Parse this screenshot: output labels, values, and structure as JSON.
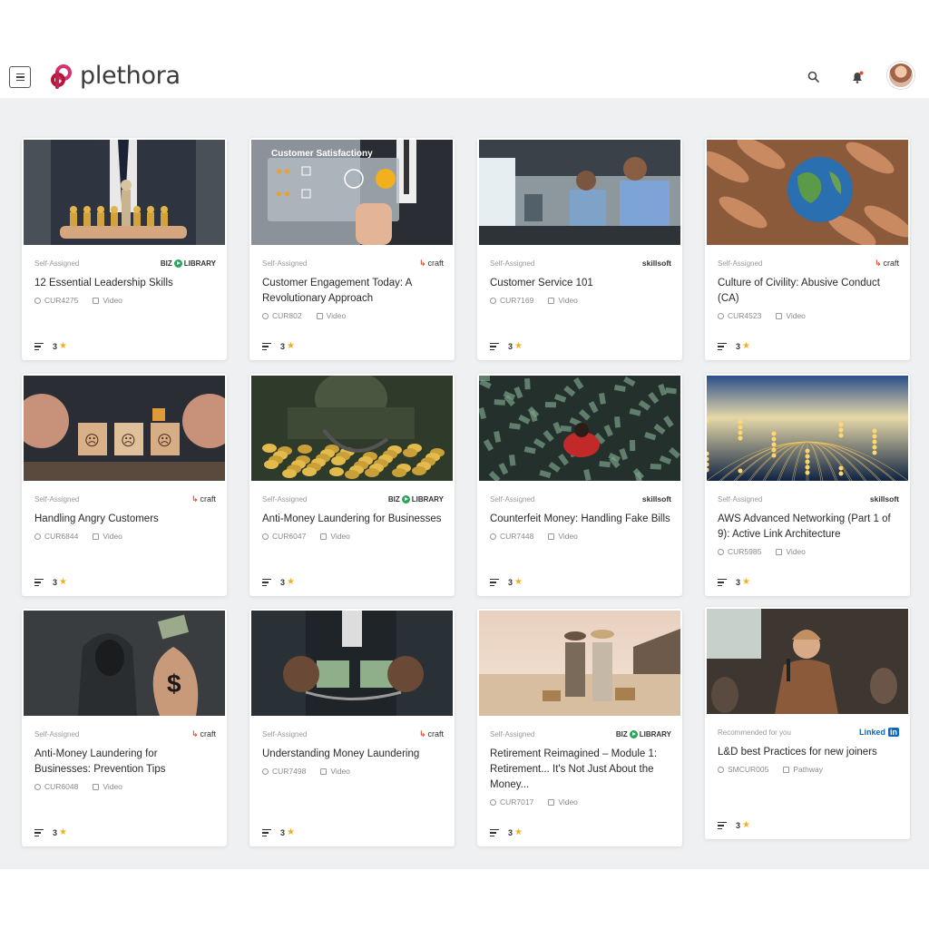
{
  "app": {
    "name": "plethora"
  },
  "colors": {
    "brand_pink": "#d6336c",
    "brand_red": "#b0183a",
    "star": "#f2b01e",
    "bg": "#eef0f2"
  },
  "header": {
    "menu_icon": "menu-icon",
    "search_icon": "search-icon",
    "bell_icon": "bell-icon",
    "avatar": "user-avatar"
  },
  "cards": [
    {
      "assign": "Self-Assigned",
      "provider": "BIZ LIBRARY",
      "title": "12 Essential Leadership Skills",
      "code": "CUR4275",
      "format": "Video",
      "rating": "3"
    },
    {
      "assign": "Self-Assigned",
      "provider": "craft",
      "title": "Customer Engagement Today: A Revolutionary Approach",
      "code": "CUR802",
      "format": "Video",
      "rating": "3",
      "thumb_text": "Customer Satisfactiony"
    },
    {
      "assign": "Self-Assigned",
      "provider": "skillsoft",
      "title": "Customer Service 101",
      "code": "CUR7169",
      "format": "Video",
      "rating": "3"
    },
    {
      "assign": "Self-Assigned",
      "provider": "craft",
      "title": "Culture of Civility: Abusive Conduct (CA)",
      "code": "CUR4523",
      "format": "Video",
      "rating": "3"
    },
    {
      "assign": "Self-Assigned",
      "provider": "craft",
      "title": "Handling Angry Customers",
      "code": "CUR6844",
      "format": "Video",
      "rating": "3"
    },
    {
      "assign": "Self-Assigned",
      "provider": "BIZ LIBRARY",
      "title": "Anti-Money Laundering for Businesses",
      "code": "CUR6047",
      "format": "Video",
      "rating": "3"
    },
    {
      "assign": "Self-Assigned",
      "provider": "skillsoft",
      "title": "Counterfeit Money: Handling Fake Bills",
      "code": "CUR7448",
      "format": "Video",
      "rating": "3"
    },
    {
      "assign": "Self-Assigned",
      "provider": "skillsoft",
      "title": "AWS Advanced Networking (Part 1 of 9): Active Link Architecture",
      "code": "CUR5985",
      "format": "Video",
      "rating": "3"
    },
    {
      "assign": "Self-Assigned",
      "provider": "craft",
      "title": "Anti-Money Laundering for Businesses: Prevention Tips",
      "code": "CUR6048",
      "format": "Video",
      "rating": "3"
    },
    {
      "assign": "Self-Assigned",
      "provider": "craft",
      "title": "Understanding Money Laundering",
      "code": "CUR7498",
      "format": "Video",
      "rating": "3"
    },
    {
      "assign": "Self-Assigned",
      "provider": "BIZ LIBRARY",
      "title": "Retirement Reimagined – Module 1: Retirement... It's Not Just About the Money...",
      "code": "CUR7017",
      "format": "Video",
      "rating": "3"
    },
    {
      "assign": "Recommended for you",
      "provider": "Linked in",
      "title": "L&D best Practices for new joiners",
      "code": "SMCUR005",
      "format": "Pathway",
      "rating": "3"
    }
  ]
}
